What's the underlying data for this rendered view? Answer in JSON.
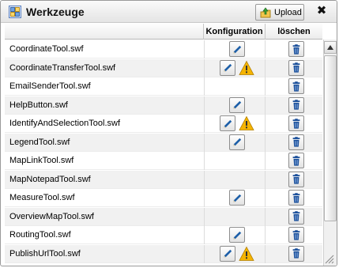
{
  "window": {
    "title": "Werkzeuge",
    "upload_label": "Upload",
    "close_label": "✖"
  },
  "table": {
    "columns": [
      "",
      "Konfiguration",
      "löschen"
    ],
    "rows": [
      {
        "name": "CoordinateTool.swf",
        "edit": true,
        "warning": false
      },
      {
        "name": "CoordinateTransferTool.swf",
        "edit": true,
        "warning": true
      },
      {
        "name": "EmailSenderTool.swf",
        "edit": false,
        "warning": false
      },
      {
        "name": "HelpButton.swf",
        "edit": true,
        "warning": false
      },
      {
        "name": "IdentifyAndSelectionTool.swf",
        "edit": true,
        "warning": true
      },
      {
        "name": "LegendTool.swf",
        "edit": true,
        "warning": false
      },
      {
        "name": "MapLinkTool.swf",
        "edit": false,
        "warning": false
      },
      {
        "name": "MapNotepadTool.swf",
        "edit": false,
        "warning": false
      },
      {
        "name": "MeasureTool.swf",
        "edit": true,
        "warning": false
      },
      {
        "name": "OverviewMapTool.swf",
        "edit": false,
        "warning": false
      },
      {
        "name": "RoutingTool.swf",
        "edit": true,
        "warning": false
      },
      {
        "name": "PublishUrlTool.swf",
        "edit": true,
        "warning": true
      }
    ]
  },
  "colors": {
    "pencil": "#1d5fa8",
    "warning": "#f5b400",
    "trash": "#1a4f9a",
    "row_alt": "#f1f1f1"
  },
  "icons": {
    "app": "tools-window-icon",
    "upload": "upload-icon",
    "edit": "pencil-icon",
    "warning": "warning-icon",
    "delete": "trash-icon"
  }
}
